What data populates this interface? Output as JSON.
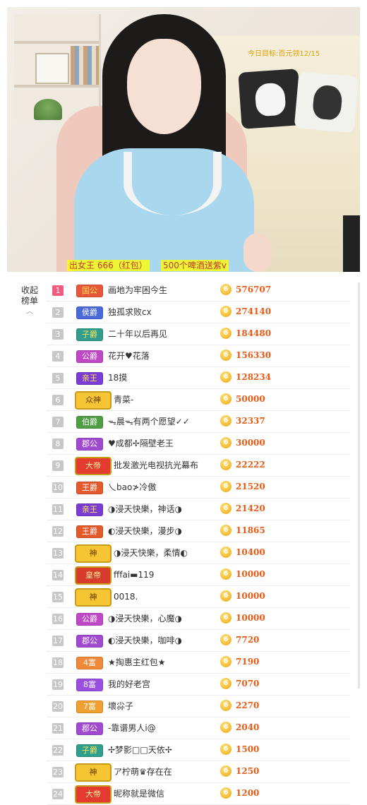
{
  "video": {
    "goal_text": "今日目标:百元领12/15",
    "gift_text": "出女王 666（红包）",
    "wine_text": "500个啤酒送紫v"
  },
  "sidebar": {
    "collapse_label_line1": "收起",
    "collapse_label_line2": "榜单",
    "collapse_icon": "chevron-up-icon"
  },
  "ranking": [
    {
      "rank": "1",
      "badge": "国公",
      "badge_type": "guogong",
      "name": "画地为牢困今生",
      "score": "576707"
    },
    {
      "rank": "2",
      "badge": "侯爵",
      "badge_type": "houjue",
      "name": "独孤求败cx",
      "score": "274140"
    },
    {
      "rank": "3",
      "badge": "子爵",
      "badge_type": "zijue",
      "name": "二十年以后再见",
      "score": "184480"
    },
    {
      "rank": "4",
      "badge": "公爵",
      "badge_type": "gongjue",
      "name": "花开♥花落",
      "score": "156330"
    },
    {
      "rank": "5",
      "badge": "亲王",
      "badge_type": "qinwang",
      "name": "18摸",
      "score": "128234"
    },
    {
      "rank": "6",
      "badge": "众神",
      "badge_type": "shen",
      "name": "青菜-",
      "score": "50000"
    },
    {
      "rank": "7",
      "badge": "伯爵",
      "badge_type": "bojue",
      "name": "ᯓ晨ᯓ有两个愿望✓✓",
      "score": "32337"
    },
    {
      "rank": "8",
      "badge": "郡公",
      "badge_type": "jungong",
      "name": "♥成都✢隔壁老王",
      "score": "30000"
    },
    {
      "rank": "9",
      "badge": "大帝",
      "badge_type": "dadi",
      "name": "批发激光电视抗光幕布",
      "score": "22222"
    },
    {
      "rank": "10",
      "badge": "王爵",
      "badge_type": "wangjue",
      "name": "乀bao≯冷傲",
      "score": "21520"
    },
    {
      "rank": "11",
      "badge": "亲王",
      "badge_type": "qinwang",
      "name": "◑浸天快樂，神话◑",
      "score": "21420"
    },
    {
      "rank": "12",
      "badge": "王爵",
      "badge_type": "wangjue",
      "name": "◐浸天快樂，漫步◑",
      "score": "11865"
    },
    {
      "rank": "13",
      "badge": "神",
      "badge_type": "shen",
      "name": "◑浸天快樂，柔情◐",
      "score": "10400"
    },
    {
      "rank": "14",
      "badge": "皇帝",
      "badge_type": "huangdi",
      "name": "fffai▬119",
      "score": "10000"
    },
    {
      "rank": "15",
      "badge": "神",
      "badge_type": "shen",
      "name": "0018.",
      "score": "10000"
    },
    {
      "rank": "16",
      "badge": "公爵",
      "badge_type": "gongjue",
      "name": "◑浸天快樂，心魔◑",
      "score": "10000"
    },
    {
      "rank": "17",
      "badge": "郡公",
      "badge_type": "jungong",
      "name": "◐浸天快樂，咖啡◑",
      "score": "7720"
    },
    {
      "rank": "18",
      "badge": "4富",
      "badge_type": "fu4",
      "name": "★掏惠主红包★",
      "score": "7190"
    },
    {
      "rank": "19",
      "badge": "8富",
      "badge_type": "fu8",
      "name": "我的好老宫",
      "score": "7070"
    },
    {
      "rank": "20",
      "badge": "7富",
      "badge_type": "fu7",
      "name": "壞尛子",
      "score": "2270"
    },
    {
      "rank": "21",
      "badge": "郡公",
      "badge_type": "jungong",
      "name": "-靠谱男人i@",
      "score": "2040"
    },
    {
      "rank": "22",
      "badge": "子爵",
      "badge_type": "zijue",
      "name": "✢梦影□□天依✢",
      "score": "1500"
    },
    {
      "rank": "23",
      "badge": "神",
      "badge_type": "shen",
      "name": "ア柠萌♛存在在",
      "score": "1250"
    },
    {
      "rank": "24",
      "badge": "大帝",
      "badge_type": "dadi",
      "name": "昵称就是微信",
      "score": "1200"
    }
  ],
  "coin_symbol": "6",
  "colors": {
    "score": "#e85b16",
    "rank_top": "#f25a80",
    "rank_default": "#c7c7c7",
    "coin": "#f0a611"
  }
}
